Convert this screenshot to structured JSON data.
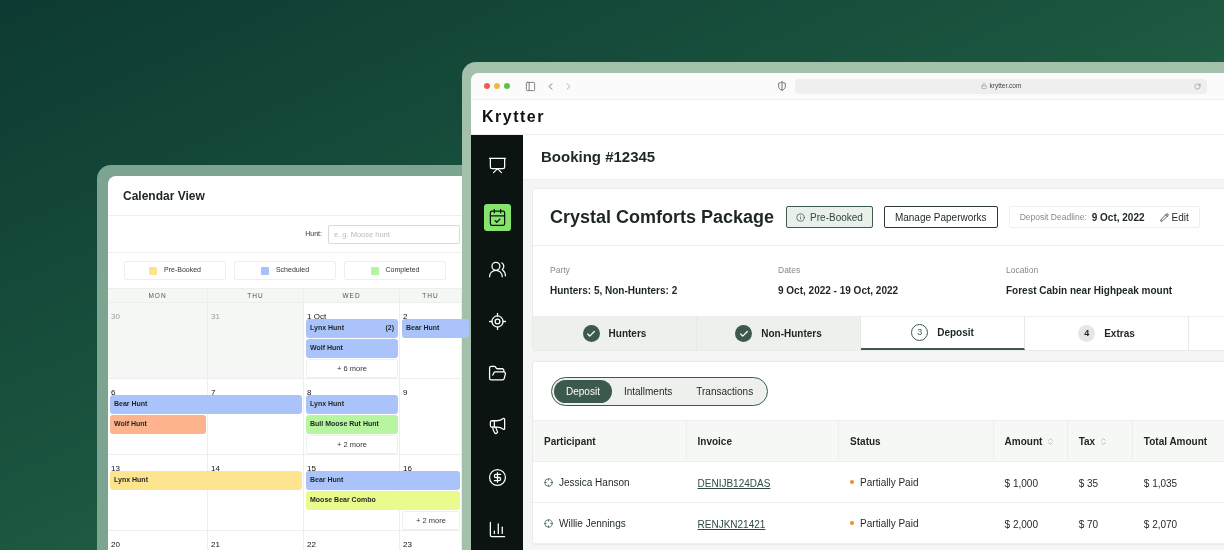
{
  "calendar": {
    "title": "Calendar View",
    "filter": {
      "label": "Hunt:",
      "placeholder": "e. g. Moose hunt"
    },
    "legend": [
      {
        "label": "Pre-Booked",
        "color": "#fde38a"
      },
      {
        "label": "Scheduled",
        "color": "#a9c0fa"
      },
      {
        "label": "Completed",
        "color": "#b5f3a2"
      }
    ],
    "weekdays": [
      "MON",
      "THU",
      "WED",
      "THU"
    ],
    "weeks": [
      {
        "days": [
          {
            "date": "30",
            "muted": true
          },
          {
            "date": "31",
            "muted": true
          },
          {
            "date": "1 Oct",
            "muted": false,
            "entries": [
              {
                "kind": "event",
                "label": "Lynx Hunt",
                "count": "(2)",
                "color": "#aac4fb",
                "extends": false
              },
              {
                "kind": "event",
                "label": "Wolf Hunt",
                "color": "#aac4fb",
                "extends": false
              },
              {
                "kind": "more",
                "label": "+ 6 more"
              }
            ]
          },
          {
            "date": "2",
            "muted": false,
            "entries": [
              {
                "kind": "event",
                "label": "Bear Hunt",
                "color": "#aac4fb",
                "extends": true
              }
            ]
          }
        ]
      },
      {
        "days": [
          {
            "date": "6",
            "muted": false,
            "entries": [
              {
                "kind": "event",
                "label": "Bear Hunt",
                "color": "#aac4fb",
                "extends": true
              },
              {
                "kind": "event",
                "label": "Wolf Hunt",
                "color": "#fcb38e",
                "extends": false
              }
            ]
          },
          {
            "date": "7",
            "muted": false
          },
          {
            "date": "8",
            "muted": false,
            "entries": [
              {
                "kind": "event",
                "label": "Lynx Hunt",
                "color": "#aac4fb",
                "extends": false
              },
              {
                "kind": "event",
                "label": "Bull Moose Rut Hunt",
                "color": "#b7f5a0",
                "extends": false
              },
              {
                "kind": "more",
                "label": "+ 2 more"
              }
            ]
          },
          {
            "date": "9",
            "muted": false
          }
        ]
      },
      {
        "days": [
          {
            "date": "13",
            "muted": false,
            "entries": [
              {
                "kind": "event",
                "label": "Lynx Hunt",
                "color": "#fde58f",
                "extends": true
              }
            ]
          },
          {
            "date": "14",
            "muted": false
          },
          {
            "date": "15",
            "muted": false,
            "entries": [
              {
                "kind": "event",
                "label": "Bear Hunt",
                "color": "#aac4fb",
                "extends": true
              },
              {
                "kind": "event",
                "label": "Moose Bear Combo",
                "color": "#e9fb8c",
                "extends": true
              }
            ]
          },
          {
            "date": "16",
            "muted": false,
            "entries": [
              {
                "kind": "gap"
              },
              {
                "kind": "gap"
              },
              {
                "kind": "more",
                "label": "+ 2 more"
              }
            ]
          }
        ]
      },
      {
        "days": [
          {
            "date": "20",
            "muted": false
          },
          {
            "date": "21",
            "muted": false
          },
          {
            "date": "22",
            "muted": false
          },
          {
            "date": "23",
            "muted": false
          }
        ]
      }
    ]
  },
  "browser": {
    "url": "krytter.com"
  },
  "app": {
    "logo": "Krytter",
    "sidebar": {
      "items": [
        {
          "selected": false
        },
        {
          "selected": true
        },
        {
          "selected": false
        },
        {
          "selected": false
        },
        {
          "selected": false
        },
        {
          "selected": false
        },
        {
          "selected": false
        },
        {
          "selected": false
        }
      ]
    },
    "page_title": "Booking #12345",
    "package": {
      "title": "Crystal Comforts Package",
      "status": "Pre-Booked",
      "action": "Manage Paperworks",
      "deadline_label": "Deposit Deadline:",
      "deadline": "9 Oct, 2022",
      "edit": "Edit"
    },
    "info": [
      {
        "label": "Party",
        "value": "Hunters: 5, Non-Hunters: 2"
      },
      {
        "label": "Dates",
        "value": "9 Oct, 2022 - 19 Oct, 2022"
      },
      {
        "label": "Location",
        "value": "Forest Cabin near Highpeak mount"
      }
    ],
    "steps": [
      {
        "label": "Hunters",
        "completed": true,
        "selected": false
      },
      {
        "label": "Non-Hunters",
        "completed": true,
        "selected": false
      },
      {
        "label": "Deposit",
        "number": "3",
        "completed": false,
        "selected": true
      },
      {
        "label": "Extras",
        "number": "4",
        "completed": false,
        "selected": false
      }
    ],
    "segments": [
      {
        "label": "Deposit",
        "selected": true
      },
      {
        "label": "Intallments",
        "selected": false
      },
      {
        "label": "Transactions",
        "selected": false
      }
    ],
    "table": {
      "columns": [
        {
          "label": "Participant",
          "sortable": false
        },
        {
          "label": "Invoice",
          "sortable": false
        },
        {
          "label": "Status",
          "sortable": false
        },
        {
          "label": "Amount",
          "sortable": true
        },
        {
          "label": "Tax",
          "sortable": true
        },
        {
          "label": "Total Amount",
          "sortable": false
        }
      ],
      "rows": [
        {
          "participant": "Jessica Hanson",
          "invoice": "DENIJB124DAS",
          "status": "Partially Paid",
          "color": "#f5892a",
          "amount": "$ 1,000",
          "tax": "$ 35",
          "total": "$ 1,035"
        },
        {
          "participant": "Willie Jennings",
          "invoice": "RENJKN21421",
          "status": "Partially Paid",
          "color": "#f5892a",
          "amount": "$ 2,000",
          "tax": "$ 70",
          "total": "$ 2,070"
        }
      ]
    }
  }
}
